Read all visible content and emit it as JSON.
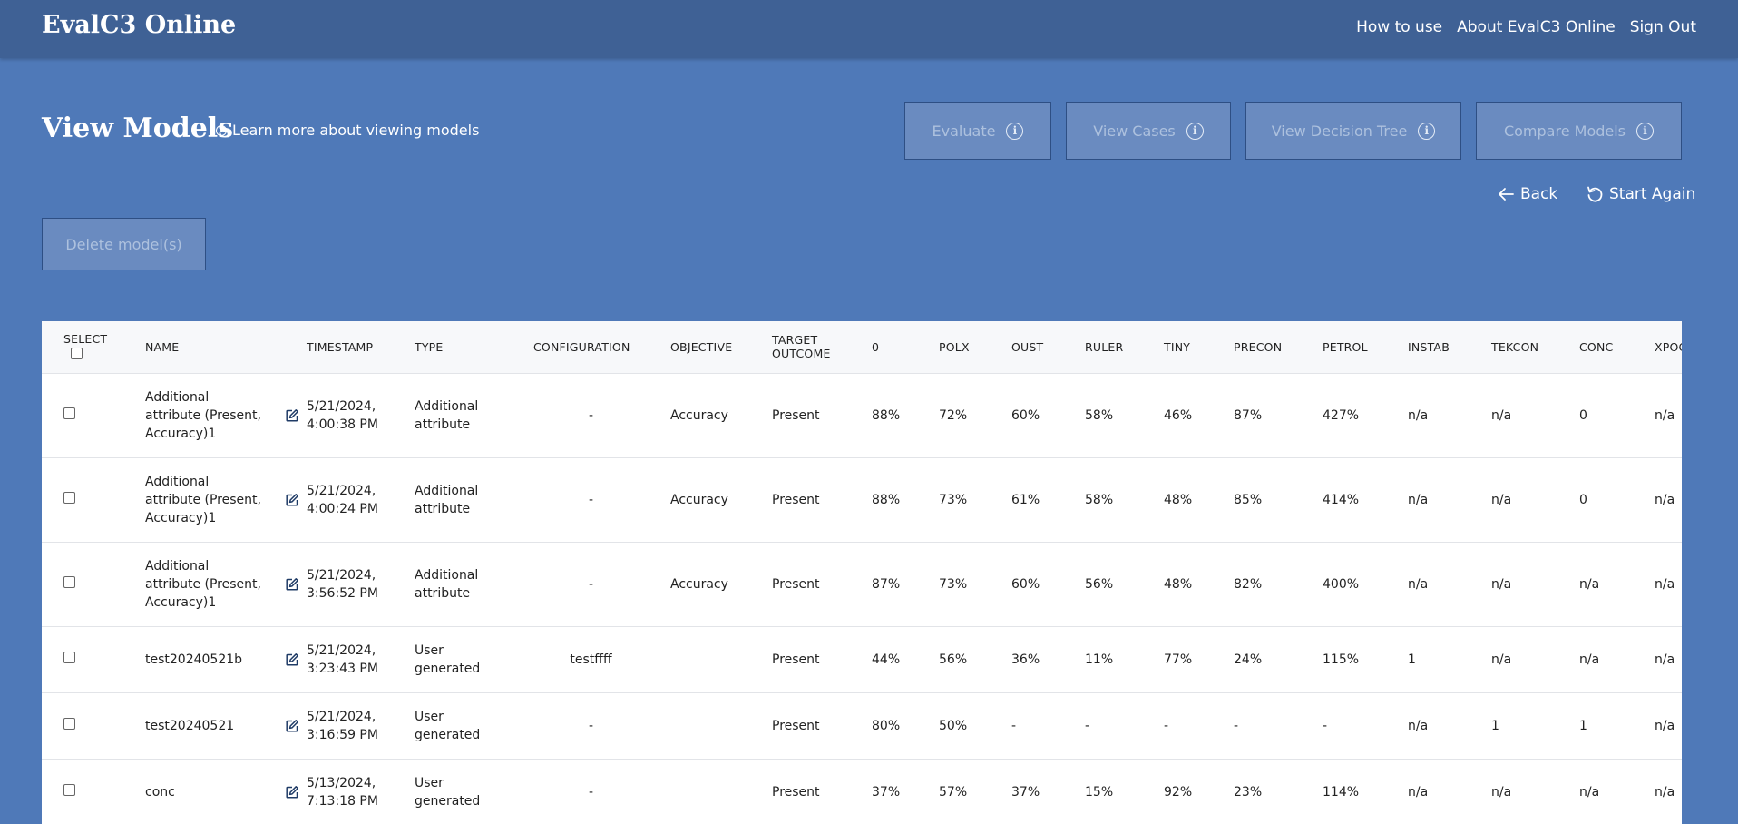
{
  "app": {
    "title": "EvalC3 Online",
    "nav": [
      "How to use",
      "About EvalC3 Online",
      "Sign Out"
    ]
  },
  "page": {
    "title": "View Models",
    "learn_more": "Learn more about viewing models"
  },
  "actions": {
    "evaluate": "Evaluate",
    "view_cases": "View Cases",
    "view_decision_tree": "View Decision Tree",
    "compare_models": "Compare Models",
    "back": "Back",
    "start_again": "Start Again",
    "delete": "Delete model(s)"
  },
  "table": {
    "headers": {
      "select": "SELECT",
      "name": "NAME",
      "timestamp": "TIMESTAMP",
      "type": "TYPE",
      "configuration": "CONFIGURATION",
      "objective": "OBJECTIVE",
      "target_outcome_1": "TARGET",
      "target_outcome_2": "OUTCOME",
      "zero": "0",
      "polx": "POLX",
      "oust": "OUST",
      "ruler": "RULER",
      "tiny": "TINY",
      "precon": "PRECON",
      "petrol": "PETROL",
      "instab": "INSTAB",
      "tekcon": "TEKCON",
      "conc": "CONC",
      "xpoc": "XPOC"
    },
    "rows": [
      {
        "name": [
          "Additional",
          "attribute (Present,",
          "Accuracy)1"
        ],
        "timestamp": [
          "5/21/2024,",
          "4:00:38 PM"
        ],
        "type": [
          "Additional",
          "attribute"
        ],
        "configuration": "-",
        "objective": "Accuracy",
        "target": "Present",
        "zero": "88%",
        "polx": "72%",
        "oust": "60%",
        "ruler": "58%",
        "tiny": "46%",
        "precon": "87%",
        "petrol": "427%",
        "instab": "n/a",
        "tekcon": "n/a",
        "conc": "0",
        "xpoc": "n/a"
      },
      {
        "name": [
          "Additional",
          "attribute (Present,",
          "Accuracy)1"
        ],
        "timestamp": [
          "5/21/2024,",
          "4:00:24 PM"
        ],
        "type": [
          "Additional",
          "attribute"
        ],
        "configuration": "-",
        "objective": "Accuracy",
        "target": "Present",
        "zero": "88%",
        "polx": "73%",
        "oust": "61%",
        "ruler": "58%",
        "tiny": "48%",
        "precon": "85%",
        "petrol": "414%",
        "instab": "n/a",
        "tekcon": "n/a",
        "conc": "0",
        "xpoc": "n/a"
      },
      {
        "name": [
          "Additional",
          "attribute (Present,",
          "Accuracy)1"
        ],
        "timestamp": [
          "5/21/2024,",
          "3:56:52 PM"
        ],
        "type": [
          "Additional",
          "attribute"
        ],
        "configuration": "-",
        "objective": "Accuracy",
        "target": "Present",
        "zero": "87%",
        "polx": "73%",
        "oust": "60%",
        "ruler": "56%",
        "tiny": "48%",
        "precon": "82%",
        "petrol": "400%",
        "instab": "n/a",
        "tekcon": "n/a",
        "conc": "n/a",
        "xpoc": "n/a"
      },
      {
        "name": [
          "test20240521b"
        ],
        "timestamp": [
          "5/21/2024,",
          "3:23:43 PM"
        ],
        "type": [
          "User",
          "generated"
        ],
        "configuration": "testffff",
        "objective": "",
        "target": "Present",
        "zero": "44%",
        "polx": "56%",
        "oust": "36%",
        "ruler": "11%",
        "tiny": "77%",
        "precon": "24%",
        "petrol": "115%",
        "instab": "1",
        "tekcon": "n/a",
        "conc": "n/a",
        "xpoc": "n/a"
      },
      {
        "name": [
          "test20240521"
        ],
        "timestamp": [
          "5/21/2024,",
          "3:16:59 PM"
        ],
        "type": [
          "User",
          "generated"
        ],
        "configuration": "-",
        "objective": "",
        "target": "Present",
        "zero": "80%",
        "polx": "50%",
        "oust": "-",
        "ruler": "-",
        "tiny": "-",
        "precon": "-",
        "petrol": "-",
        "instab": "n/a",
        "tekcon": "1",
        "conc": "1",
        "xpoc": "n/a"
      },
      {
        "name": [
          "conc"
        ],
        "timestamp": [
          "5/13/2024,",
          "7:13:18 PM"
        ],
        "type": [
          "User",
          "generated"
        ],
        "configuration": "-",
        "objective": "",
        "target": "Present",
        "zero": "37%",
        "polx": "57%",
        "oust": "37%",
        "ruler": "15%",
        "tiny": "92%",
        "precon": "23%",
        "petrol": "114%",
        "instab": "n/a",
        "tekcon": "n/a",
        "conc": "n/a",
        "xpoc": "n/a"
      }
    ]
  }
}
